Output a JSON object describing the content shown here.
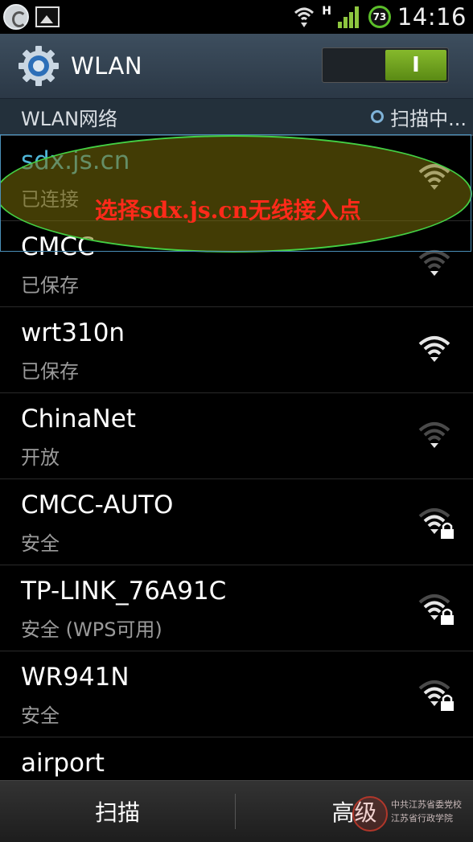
{
  "status_bar": {
    "network_type": "H",
    "battery_level": "73",
    "time": "14:16"
  },
  "action_bar": {
    "title": "WLAN",
    "toggle_label": "I"
  },
  "section": {
    "title": "WLAN网络",
    "scan_status": "扫描中..."
  },
  "networks": [
    {
      "name": "sdx.js.cn",
      "status": "已连接",
      "secured": false,
      "signal": "strong",
      "state": "connected"
    },
    {
      "name": "CMCC",
      "status": "已保存",
      "secured": false,
      "signal": "weak",
      "state": "saved"
    },
    {
      "name": "wrt310n",
      "status": "已保存",
      "secured": false,
      "signal": "strong",
      "state": "saved"
    },
    {
      "name": "ChinaNet",
      "status": "开放",
      "secured": false,
      "signal": "weak",
      "state": "open"
    },
    {
      "name": "CMCC-AUTO",
      "status": "安全",
      "secured": true,
      "signal": "medium",
      "state": "secured"
    },
    {
      "name": "TP-LINK_76A91C",
      "status": "安全 (WPS可用)",
      "secured": true,
      "signal": "medium",
      "state": "secured"
    },
    {
      "name": "WR941N",
      "status": "安全",
      "secured": true,
      "signal": "medium",
      "state": "secured"
    },
    {
      "name": "airport",
      "status": "",
      "secured": false,
      "signal": "weak",
      "state": "open"
    }
  ],
  "annotation": "选择sdx.js.cn无线接入点",
  "bottom_bar": {
    "scan_label": "扫描",
    "advanced_label": "高级"
  },
  "watermark": {
    "line1": "中共江苏省委党校",
    "line2": "江苏省行政学院"
  },
  "colors": {
    "connected_name": "#4fb6d8",
    "toggle_on": "#6ea11e",
    "annotation": "#ff2a1a",
    "ellipse": "#44d044"
  }
}
